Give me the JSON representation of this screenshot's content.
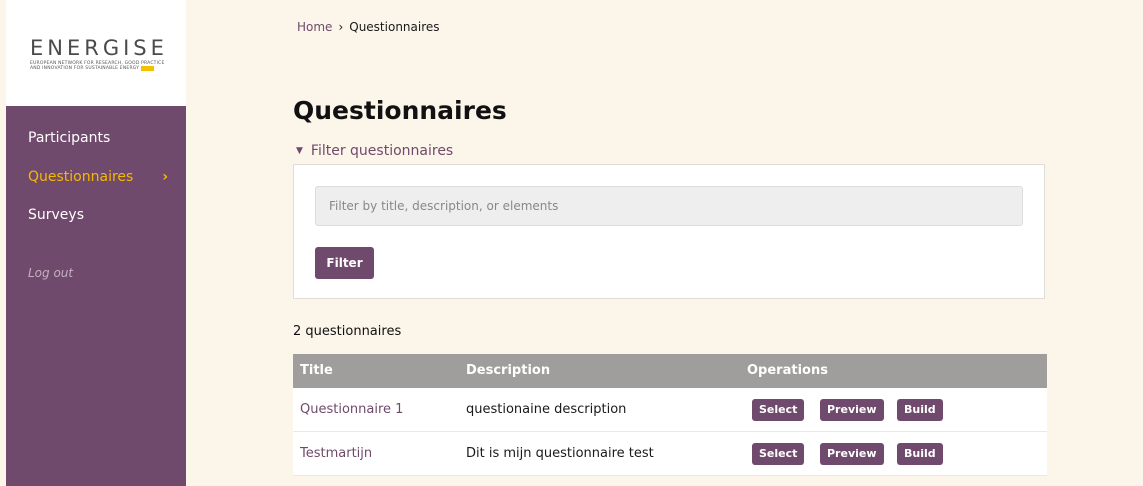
{
  "brand": {
    "name": "ENERGISE",
    "tagline_line1": "EUROPEAN NETWORK FOR RESEARCH, GOOD PRACTICE",
    "tagline_line2": "AND INNOVATION FOR SUSTAINABLE ENERGY"
  },
  "sidebar": {
    "items": [
      {
        "label": "Participants"
      },
      {
        "label": "Questionnaires",
        "chevron": "›"
      },
      {
        "label": "Surveys"
      },
      {
        "label": "Log out"
      }
    ]
  },
  "breadcrumb": {
    "home": "Home",
    "separator": "›",
    "current": "Questionnaires"
  },
  "page": {
    "title": "Questionnaires"
  },
  "filter": {
    "toggle_label": "Filter questionnaires",
    "toggle_icon": "▼",
    "placeholder": "Filter by title, description, or elements",
    "value": "",
    "button_label": "Filter"
  },
  "results": {
    "count_label": "2 questionnaires"
  },
  "table": {
    "headers": [
      "Title",
      "Description",
      "Operations"
    ],
    "rows": [
      {
        "title": "Questionnaire 1",
        "description": "questionaine description",
        "ops": [
          "Select",
          "Preview",
          "Build"
        ]
      },
      {
        "title": "Testmartijn",
        "description": "Dit is mijn questionnaire test",
        "ops": [
          "Select",
          "Preview",
          "Build"
        ]
      }
    ]
  },
  "colors": {
    "accent": "#704a6c",
    "highlight": "#f5b800",
    "background": "#fbf5ea",
    "table_header": "#a09e9c"
  }
}
